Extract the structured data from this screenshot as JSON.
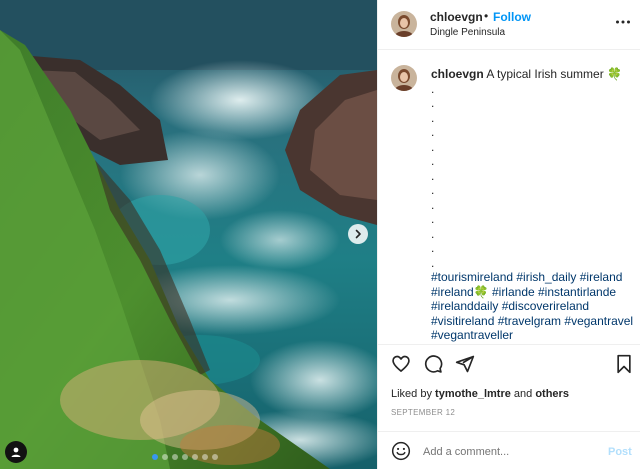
{
  "post": {
    "username": "chloevgn",
    "separator": "•",
    "follow_label": "Follow",
    "location": "Dingle Peninsula",
    "more_icon": "more-horizontal-icon",
    "caption_text": "A typical Irish summer 🍀",
    "caption_dots": [
      ".",
      ".",
      ".",
      ".",
      ".",
      ".",
      ".",
      ".",
      ".",
      ".",
      ".",
      ".",
      "."
    ],
    "hashtags": "#tourismireland #irish_daily #ireland #ireland🍀 #irlande #instantirlande #irelanddaily #discoverireland #visitireland #travelgram #vegantravel #vegantraveller",
    "likes_prefix": "Liked by",
    "likes_user": "tymothe_lmtre",
    "likes_and": "and",
    "likes_others": "others",
    "date": "SEPTEMBER 12",
    "comment_placeholder": "Add a comment...",
    "post_label": "Post"
  },
  "carousel": {
    "slide_count": 7,
    "active_index": 0
  },
  "colors": {
    "accent": "#0095f6",
    "link": "#00376b",
    "post_disabled": "#b2dffc",
    "carousel_active_dot": "#3897f0"
  }
}
